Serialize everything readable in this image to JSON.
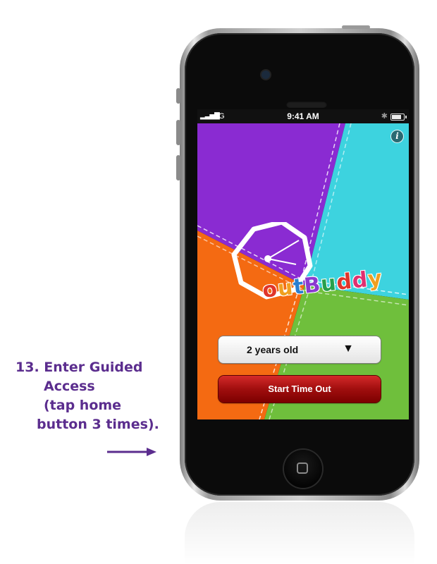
{
  "instruction": {
    "line1": "13. Enter Guided",
    "line2": "Access",
    "line3": "(tap home",
    "line4": "button 3 times).",
    "arrow_color": "#5b2d8e"
  },
  "status_bar": {
    "signal": "▂▃▅▇",
    "carrier": "3G",
    "time": "9:41 AM",
    "bluetooth": "✱"
  },
  "app": {
    "info_icon": "i",
    "brand_letters": [
      "o",
      "u",
      "t",
      "B",
      "u",
      "d",
      "d",
      "y"
    ],
    "age_select": {
      "value": "2 years old",
      "caret": "▼"
    },
    "start_button": "Start Time Out",
    "colors": {
      "purple": "#8a2bd2",
      "cyan": "#3dd3df",
      "orange": "#f46a12",
      "green": "#6fbf3c",
      "button_red": "#a00e0e"
    }
  }
}
